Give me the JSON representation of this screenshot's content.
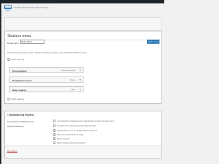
{
  "header": {
    "button_label": "Szybkie menu",
    "notice": "Przyszły dla zapewniony zapisać zmiany."
  },
  "structure": {
    "title": "Struktura menu",
    "name_label": "Nazwa menu",
    "name_value": "Dolne Menu",
    "save_label": "Zapisz menu",
    "instruction": "Przesuń elementy aby je ułożyć. Kliknij w strzałkę po prawej, żeby wyświetlić dodatkowe opcje.",
    "bulk_top": "Wybór masowy",
    "bulk_bottom": "Wybór masowy",
    "items": [
      {
        "title": "Strona główna",
        "type": "Własny odnośnik"
      },
      {
        "title": "Przykładowa strona",
        "type": "Strona"
      },
      {
        "title": "Witaj, świecie!",
        "type": "Wpis"
      }
    ],
    "toggle_glyph": "▾"
  },
  "settings": {
    "title": "Ustawienia menu",
    "auto_add_label": "Automatyczne dodawanie stron",
    "auto_add_option": "Automatycznie dodawaj strony najwyższego poziomu do tego menu",
    "location_label": "Wyświetl lokalizację",
    "locations": [
      {
        "label": "Przycisk menu dla komputerów stacjonarnych",
        "checked": false
      },
      {
        "label": "Wyświetlanie menu na urządzeniach mobilnych",
        "checked": false
      },
      {
        "label": "Menu lub wyrównanie do lewej",
        "checked": false
      },
      {
        "label": "Menu w stopce",
        "checked": true
      },
      {
        "label": "Menu mediów społecznościowych",
        "checked": false
      }
    ],
    "check_mark": "✓"
  },
  "footer": {
    "delete_label": "Usuń Menu"
  }
}
